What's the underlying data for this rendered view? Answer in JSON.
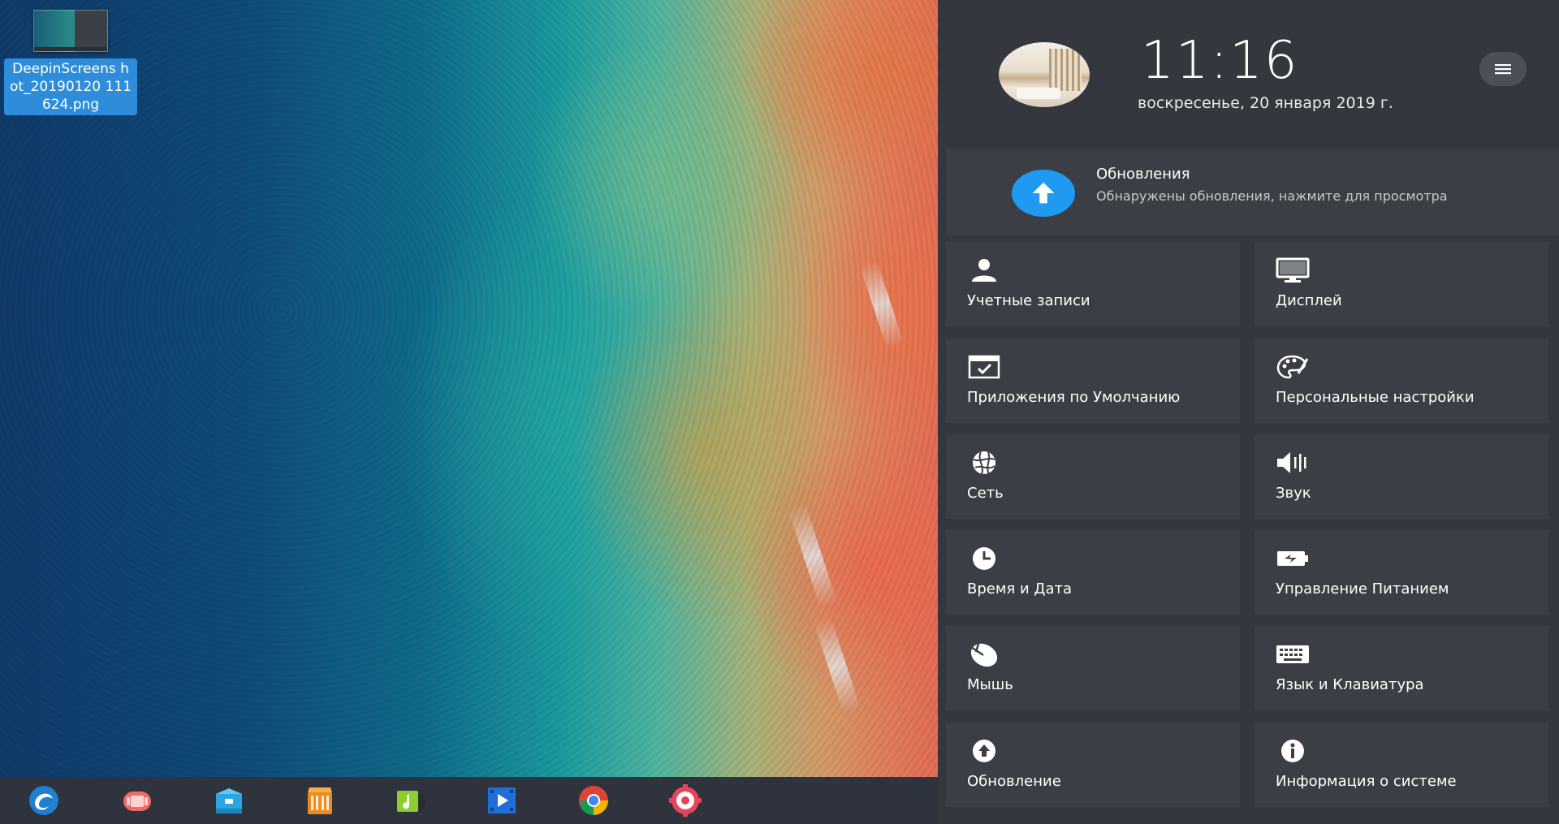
{
  "desktop": {
    "icon": {
      "name": "DeepinScreenshot_20190120111624.png",
      "name_display": "DeepinScreens hot_20190120 111624.png"
    }
  },
  "dock": {
    "items": [
      {
        "icon": "deepin-launcher-icon"
      },
      {
        "icon": "multitasking-view-icon"
      },
      {
        "icon": "file-manager-icon"
      },
      {
        "icon": "app-store-icon"
      },
      {
        "icon": "music-player-icon"
      },
      {
        "icon": "movie-player-icon"
      },
      {
        "icon": "chrome-browser-icon"
      },
      {
        "icon": "control-center-icon"
      }
    ]
  },
  "control_center": {
    "time": "11:16",
    "date": "воскресенье, 20 января 2019 г.",
    "update_card": {
      "title": "Обновления",
      "description": "Обнаружены обновления, нажмите для просмотра",
      "accent": "#1f9af0"
    },
    "tiles": [
      {
        "icon": "user-icon",
        "label": "Учетные записи"
      },
      {
        "icon": "display-icon",
        "label": "Дисплей"
      },
      {
        "icon": "default-apps-icon",
        "label": "Приложения по Умолчанию"
      },
      {
        "icon": "personalization-icon",
        "label": "Персональные настройки"
      },
      {
        "icon": "network-icon",
        "label": "Сеть"
      },
      {
        "icon": "sound-icon",
        "label": "Звук"
      },
      {
        "icon": "clock-icon",
        "label": "Время и Дата"
      },
      {
        "icon": "power-icon",
        "label": "Управление Питанием"
      },
      {
        "icon": "mouse-icon",
        "label": "Мышь"
      },
      {
        "icon": "keyboard-icon",
        "label": "Язык и  Клавиатура"
      },
      {
        "icon": "update-icon",
        "label": "Обновление"
      },
      {
        "icon": "info-icon",
        "label": "Информация о системе"
      }
    ]
  },
  "colors": {
    "panel_bg": "#34383e",
    "tile_bg": "#3b3f45",
    "selection": "#2e8ddb"
  }
}
